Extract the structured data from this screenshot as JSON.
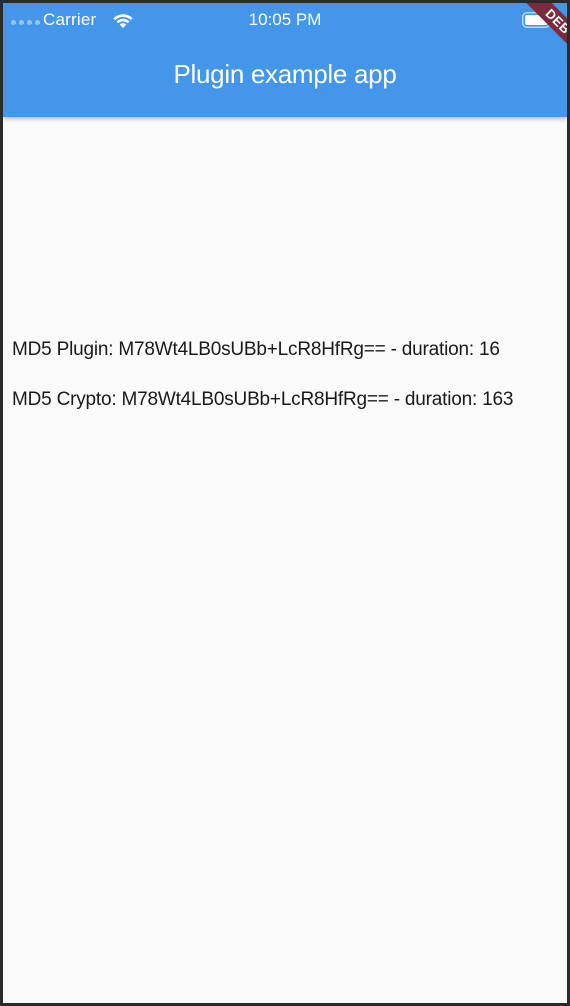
{
  "status_bar": {
    "carrier": "Carrier",
    "time": "10:05 PM",
    "signal_icon": "signal-dots-icon",
    "wifi_icon": "wifi-icon",
    "battery_icon": "battery-icon"
  },
  "app_bar": {
    "title": "Plugin example app",
    "color": "#4396ea"
  },
  "debug_banner": {
    "label": "DEBUG",
    "color": "#7d2a3d"
  },
  "results": [
    {
      "text": "MD5 Plugin: M78Wt4LB0sUBb+LcR8HfRg== - duration: 16"
    },
    {
      "text": "MD5 Crypto: M78Wt4LB0sUBb+LcR8HfRg== - duration: 163"
    }
  ]
}
